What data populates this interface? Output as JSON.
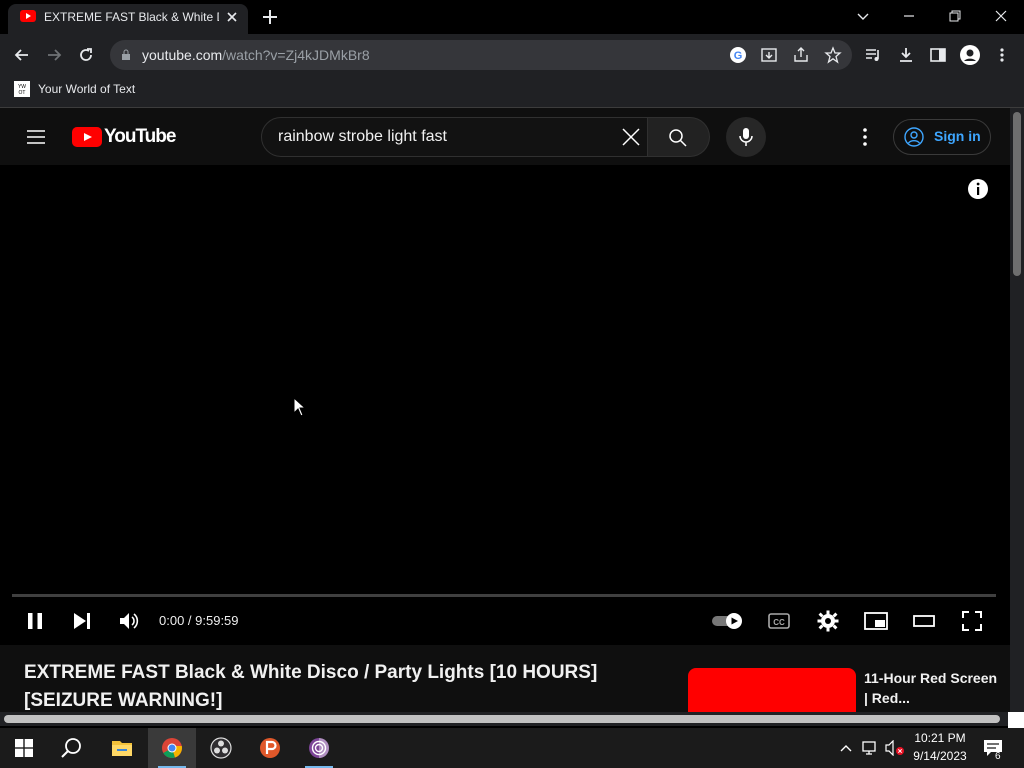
{
  "browser": {
    "tab_title": "EXTREME FAST Black & White Di",
    "url_host": "youtube.com",
    "url_path": "/watch?v=Zj4kJDMkBr8",
    "bookmark_label": "Your World of Text"
  },
  "youtube": {
    "logo_text": "YouTube",
    "search_value": "rainbow strobe light fast",
    "signin_label": "Sign in"
  },
  "player": {
    "time_display": "0:00 / 9:59:59",
    "progress": 0.0,
    "state": "playing"
  },
  "video": {
    "title": "EXTREME FAST Black & White Disco / Party Lights [10 HOURS] [SEIZURE WARNING!]"
  },
  "recommendation": {
    "title": "11-Hour Red Screen | Red..."
  },
  "taskbar": {
    "time": "10:21 PM",
    "date": "9/14/2023",
    "notification_count": "6",
    "apps": [
      "file-explorer",
      "chrome",
      "obs",
      "psiphon",
      "tor-browser"
    ]
  },
  "colors": {
    "youtube_red": "#ff0000",
    "signin_blue": "#3ea6ff",
    "chrome_dark": "#202124"
  }
}
